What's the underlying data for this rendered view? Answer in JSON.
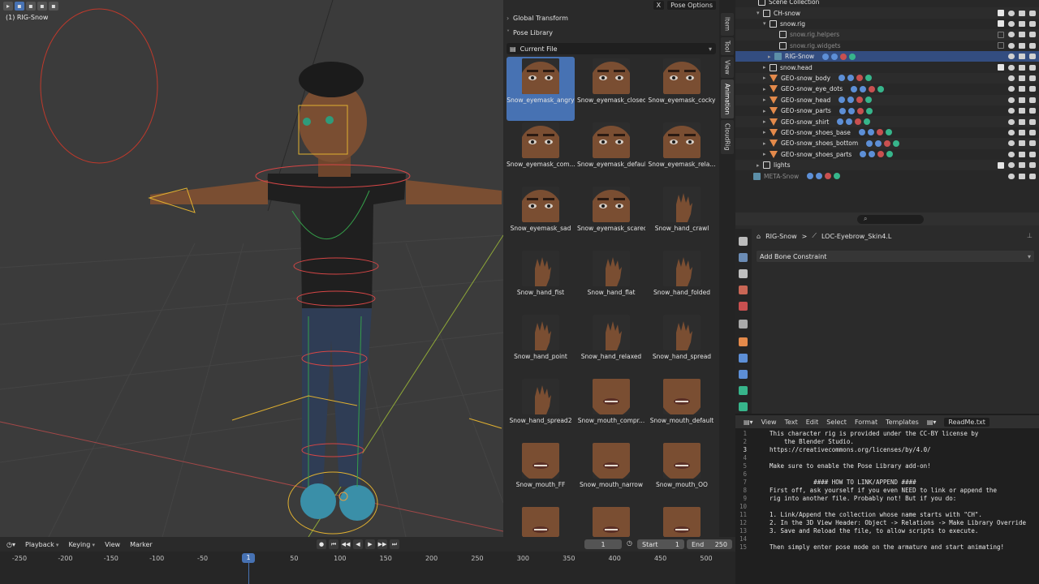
{
  "viewport": {
    "object_label": "(1) RIG-Snow"
  },
  "sidebar": {
    "top_button": "Pose Options",
    "top_close": "X",
    "sections": [
      "Global Transform",
      "Pose Library"
    ],
    "current_file_label": "Current File",
    "assets": [
      {
        "label": "Snow_eyemask_angry",
        "kind": "face",
        "selected": true
      },
      {
        "label": "Snow_eyemask_closed",
        "kind": "face"
      },
      {
        "label": "Snow_eyemask_cocky",
        "kind": "face"
      },
      {
        "label": "Snow_eyemask_com...",
        "kind": "face"
      },
      {
        "label": "Snow_eyemask_default",
        "kind": "face"
      },
      {
        "label": "Snow_eyemask_rela...",
        "kind": "face"
      },
      {
        "label": "Snow_eyemask_sad",
        "kind": "face"
      },
      {
        "label": "Snow_eyemask_scared",
        "kind": "face"
      },
      {
        "label": "Snow_hand_crawl",
        "kind": "hand"
      },
      {
        "label": "Snow_hand_fist",
        "kind": "hand"
      },
      {
        "label": "Snow_hand_flat",
        "kind": "hand"
      },
      {
        "label": "Snow_hand_folded",
        "kind": "hand"
      },
      {
        "label": "Snow_hand_point",
        "kind": "hand"
      },
      {
        "label": "Snow_hand_relaxed",
        "kind": "hand"
      },
      {
        "label": "Snow_hand_spread",
        "kind": "hand"
      },
      {
        "label": "Snow_hand_spread2",
        "kind": "hand"
      },
      {
        "label": "Snow_mouth_compr...",
        "kind": "mouth"
      },
      {
        "label": "Snow_mouth_default",
        "kind": "mouth"
      },
      {
        "label": "Snow_mouth_FF",
        "kind": "mouth"
      },
      {
        "label": "Snow_mouth_narrow",
        "kind": "mouth"
      },
      {
        "label": "Snow_mouth_OO",
        "kind": "mouth"
      },
      {
        "label": "",
        "kind": "mouth"
      },
      {
        "label": "",
        "kind": "mouth"
      },
      {
        "label": "",
        "kind": "mouth"
      }
    ],
    "vertical_tabs": [
      "Item",
      "Tool",
      "View",
      "Animation",
      "CloudRig"
    ]
  },
  "outliner": {
    "rows": [
      {
        "name": "Scene Collection",
        "icon": "coll",
        "exp": "",
        "checked": null
      },
      {
        "name": "CH-snow",
        "icon": "coll",
        "exp": "▾",
        "checked": true
      },
      {
        "name": "snow.rig",
        "icon": "coll",
        "exp": "▾",
        "checked": true
      },
      {
        "name": "snow.rig.helpers",
        "icon": "coll",
        "exp": "",
        "checked": false,
        "dim": true
      },
      {
        "name": "snow.rig.widgets",
        "icon": "coll",
        "exp": "",
        "checked": false,
        "dim": true
      },
      {
        "name": "RIG-Snow",
        "icon": "arm",
        "exp": "▸",
        "checked": null,
        "selected": true
      },
      {
        "name": "snow.head",
        "icon": "coll",
        "exp": "▸",
        "checked": true
      },
      {
        "name": "GEO-snow_body",
        "icon": "mesh",
        "exp": "▸",
        "checked": null
      },
      {
        "name": "GEO-snow_eye_dots",
        "icon": "mesh",
        "exp": "▸",
        "checked": null
      },
      {
        "name": "GEO-snow_head",
        "icon": "mesh",
        "exp": "▸",
        "checked": null
      },
      {
        "name": "GEO-snow_parts",
        "icon": "mesh",
        "exp": "▸",
        "checked": null
      },
      {
        "name": "GEO-snow_shirt",
        "icon": "mesh",
        "exp": "▸",
        "checked": null
      },
      {
        "name": "GEO-snow_shoes_base",
        "icon": "mesh",
        "exp": "▸",
        "checked": null
      },
      {
        "name": "GEO-snow_shoes_bottom",
        "icon": "mesh",
        "exp": "▸",
        "checked": null
      },
      {
        "name": "GEO-snow_shoes_parts",
        "icon": "mesh",
        "exp": "▸",
        "checked": null
      },
      {
        "name": "lights",
        "icon": "coll",
        "exp": "▸",
        "checked": true
      },
      {
        "name": "META-Snow",
        "icon": "arm",
        "exp": "",
        "checked": null,
        "dim": true
      }
    ]
  },
  "properties": {
    "breadcrumb_object": "RIG-Snow",
    "breadcrumb_sep": ">",
    "breadcrumb_bone": "LOC-Eyebrow_Skin4.L",
    "add_constraint_label": "Add Bone Constraint"
  },
  "text_editor": {
    "menus": [
      "View",
      "Text",
      "Edit",
      "Select",
      "Format",
      "Templates"
    ],
    "filename": "ReadMe.txt",
    "current_line": 3,
    "lines": [
      "This character rig is provided under the CC-BY license by",
      "    the Blender Studio.",
      "https://creativecommons.org/licenses/by/4.0/",
      "",
      "Make sure to enable the Pose Library add-on!",
      "",
      "            #### HOW TO LINK/APPEND ####",
      "First off, ask yourself if you even NEED to link or append the",
      "rig into another file. Probably not! But if you do:",
      "",
      "1. Link/Append the collection whose name starts with \"CH\".",
      "2. In the 3D View Header: Object -> Relations -> Make Library Override",
      "3. Save and Reload the file, to allow scripts to execute.",
      "",
      "Then simply enter pose mode on the armature and start animating!"
    ]
  },
  "timeline": {
    "menus": [
      "Playback",
      "Keying",
      "View",
      "Marker"
    ],
    "current_frame": "1",
    "start_label": "Start",
    "start_value": "1",
    "end_label": "End",
    "end_value": "250",
    "ruler_ticks": [
      "-250",
      "-200",
      "-150",
      "-100",
      "-50",
      "1",
      "50",
      "100",
      "150",
      "200",
      "250",
      "300",
      "350",
      "400",
      "450",
      "500"
    ]
  },
  "colors": {
    "accent": "#4772b3",
    "selection_row": "#334d80",
    "mesh_icon": "#e48a4b",
    "armature_icon": "#5c8fa8",
    "skin": "#7a4e32",
    "shirt": "#1f1f1f",
    "jeans": "#2f3d55",
    "shoes": "#3a8fa8"
  }
}
